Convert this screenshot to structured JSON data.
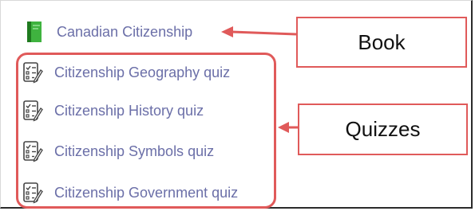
{
  "book": {
    "label": "Canadian Citizenship",
    "icon": "book-icon"
  },
  "quizzes": [
    {
      "label": "Citizenship Geography quiz",
      "icon": "quiz-icon"
    },
    {
      "label": "Citizenship History quiz",
      "icon": "quiz-icon"
    },
    {
      "label": "Citizenship Symbols quiz",
      "icon": "quiz-icon"
    },
    {
      "label": "Citizenship Government quiz",
      "icon": "quiz-icon"
    }
  ],
  "annotations": {
    "book_callout": "Book",
    "quizzes_callout": "Quizzes"
  },
  "colors": {
    "link": "#6b6fa8",
    "annotation": "#e05a5a",
    "book_green": "#3aa83a"
  }
}
